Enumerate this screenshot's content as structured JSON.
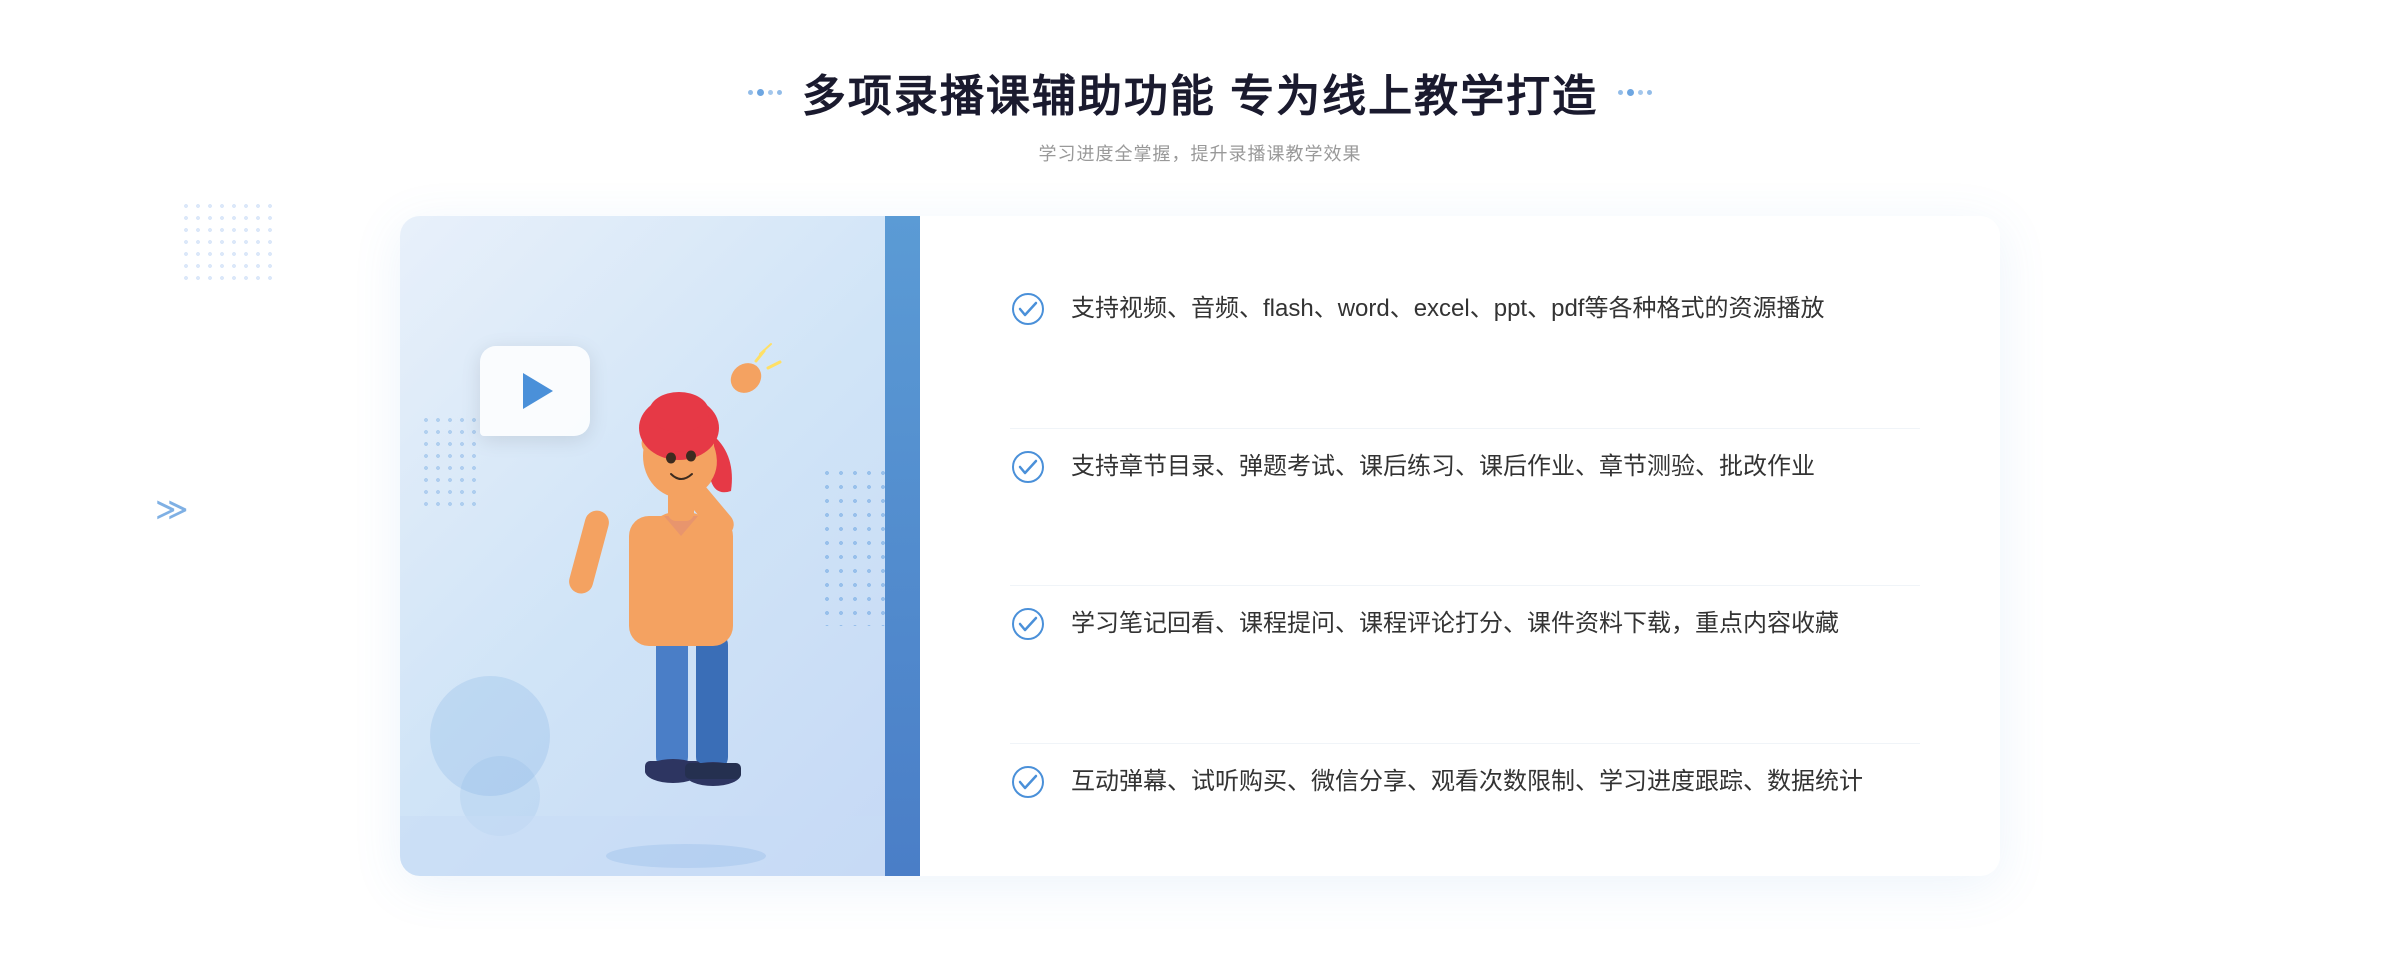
{
  "page": {
    "title": "多项录播课辅助功能 专为线上教学打造",
    "subtitle": "学习进度全掌握，提升录播课教学效果",
    "features": [
      {
        "id": 1,
        "text": "支持视频、音频、flash、word、excel、ppt、pdf等各种格式的资源播放"
      },
      {
        "id": 2,
        "text": "支持章节目录、弹题考试、课后练习、课后作业、章节测验、批改作业"
      },
      {
        "id": 3,
        "text": "学习笔记回看、课程提问、课程评论打分、课件资料下载，重点内容收藏"
      },
      {
        "id": 4,
        "text": "互动弹幕、试听购买、微信分享、观看次数限制、学习进度跟踪、数据统计"
      }
    ],
    "colors": {
      "primary": "#4a90d9",
      "title": "#1a1a2e",
      "text": "#333333",
      "subtitle": "#999999"
    }
  }
}
